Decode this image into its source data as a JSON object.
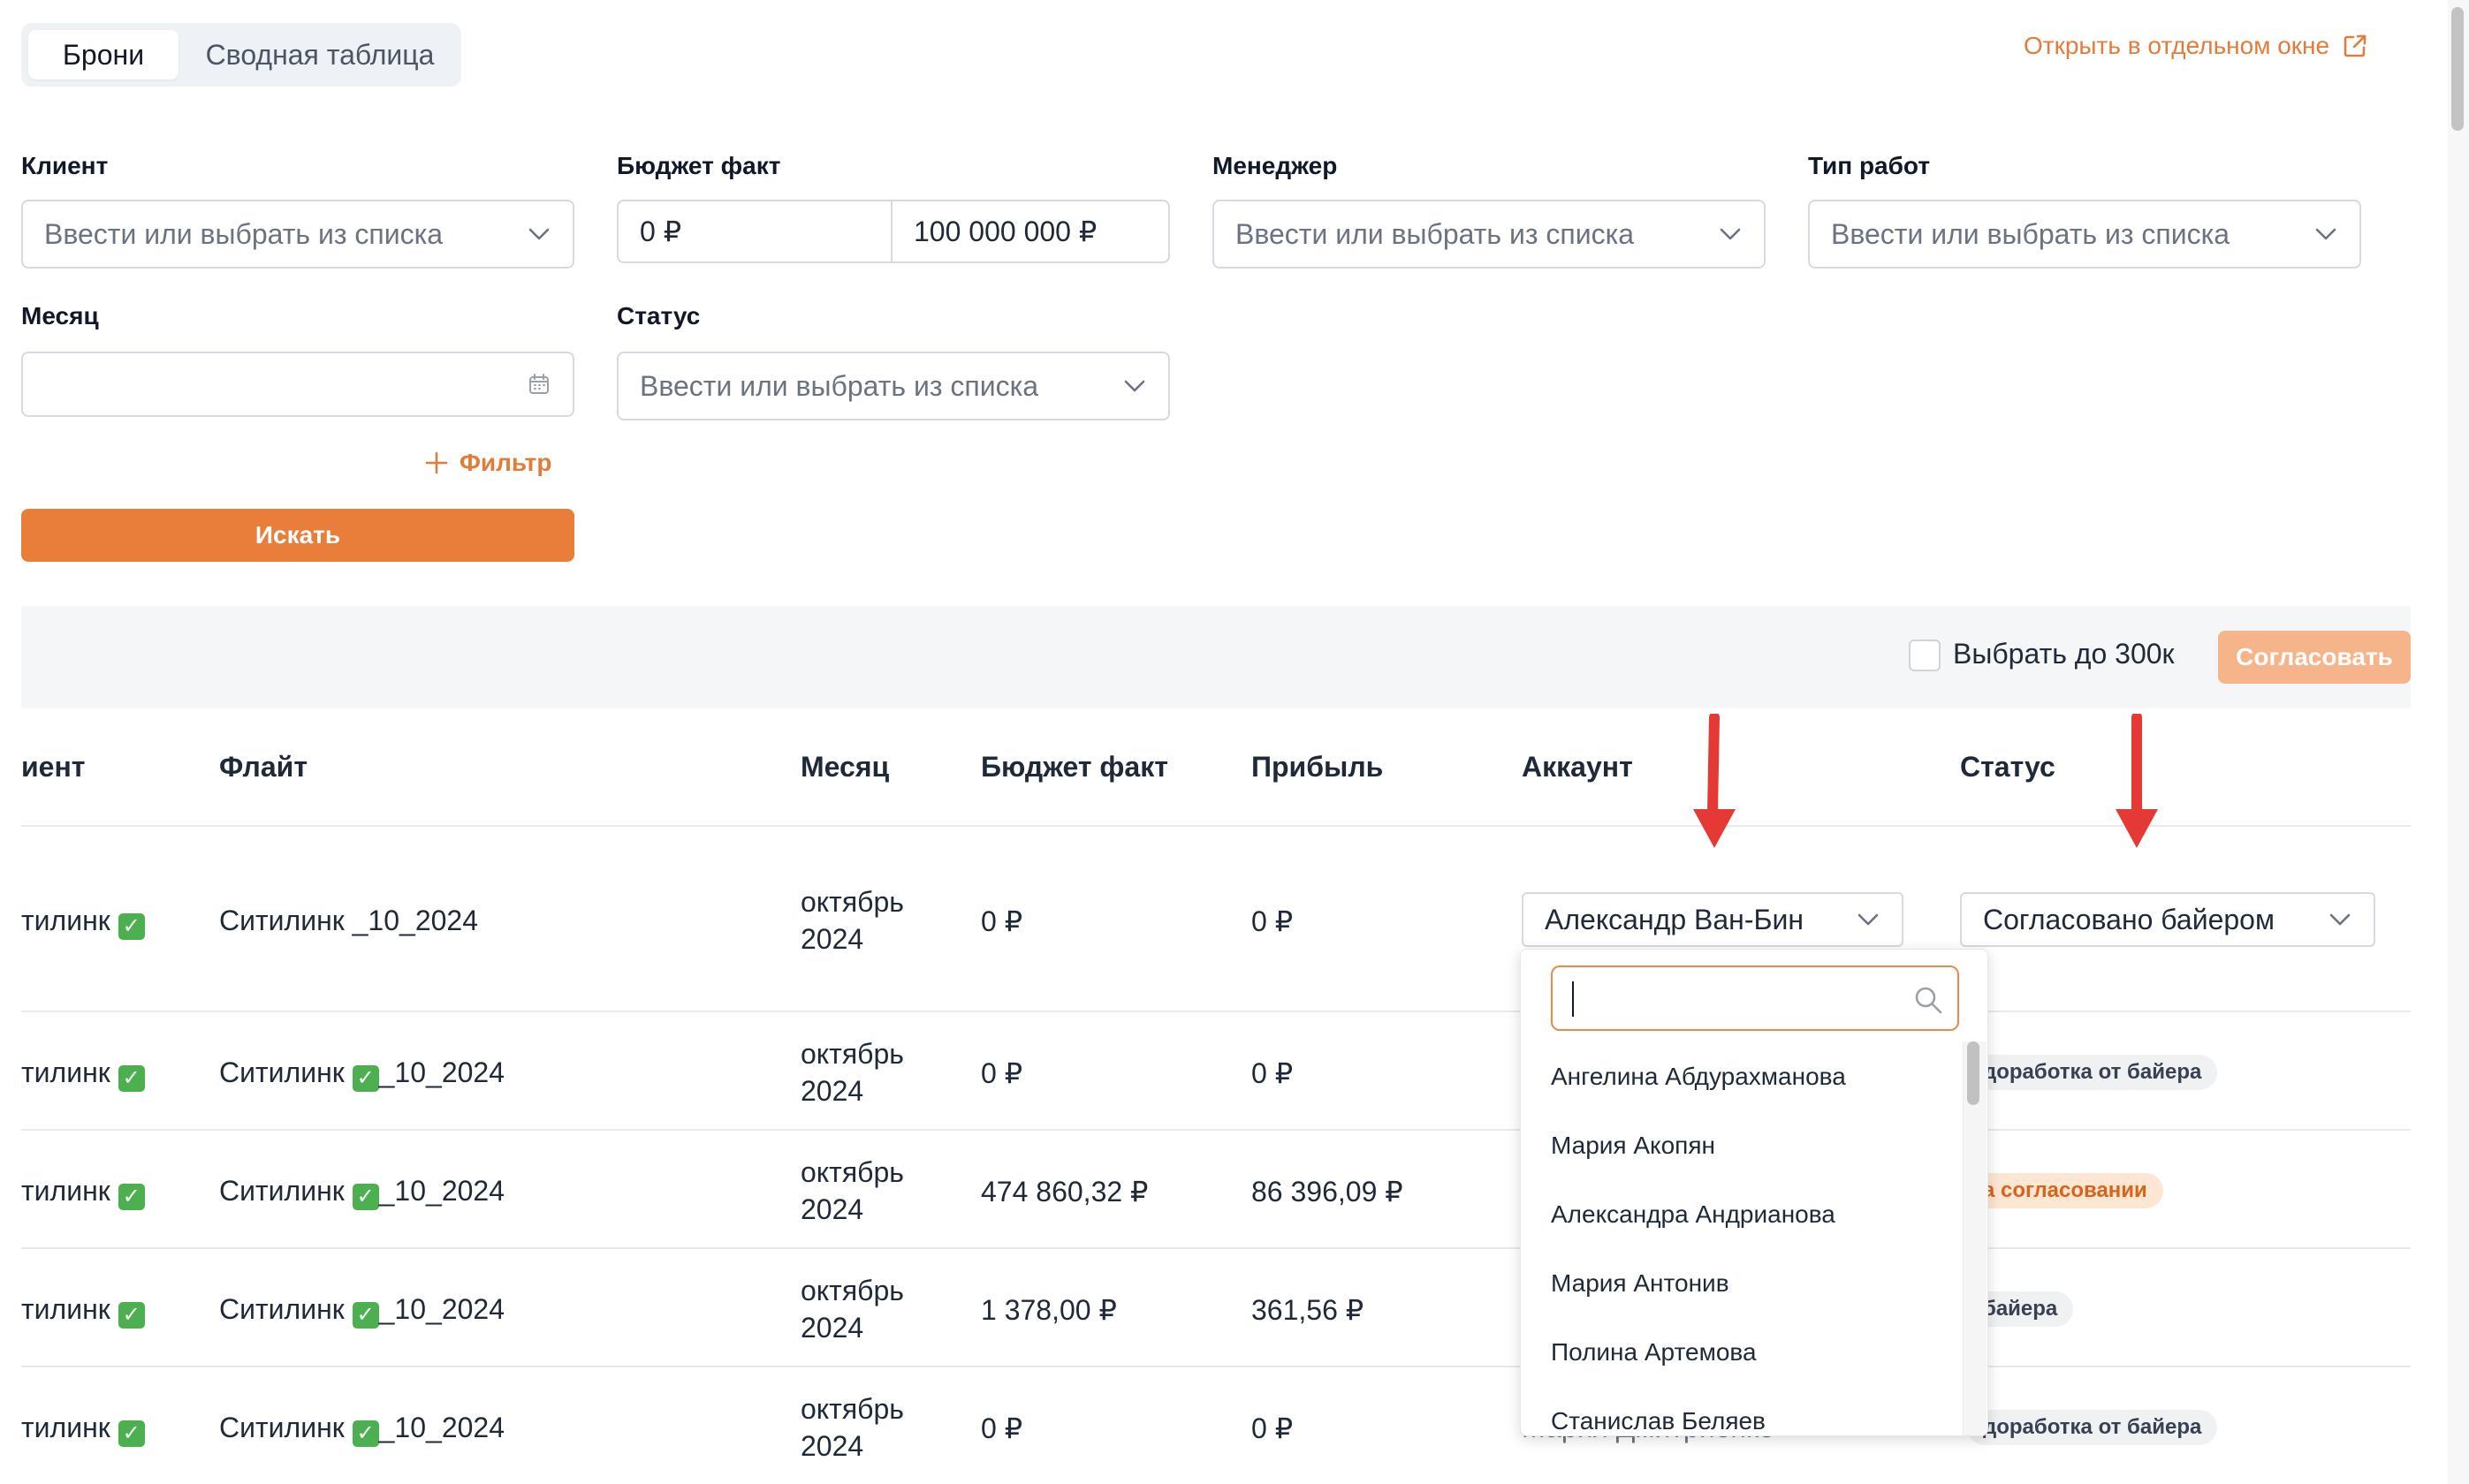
{
  "tabs": [
    "Брони",
    "Сводная таблица"
  ],
  "open_window_link": "Открыть в отдельном окне",
  "filters": {
    "client": {
      "label": "Клиент",
      "placeholder": "Ввести или выбрать из списка"
    },
    "budget": {
      "label": "Бюджет факт",
      "from": "0 ₽",
      "to": "100 000 000 ₽"
    },
    "manager": {
      "label": "Менеджер",
      "placeholder": "Ввести или выбрать из списка"
    },
    "work_type": {
      "label": "Тип работ",
      "placeholder": "Ввести или выбрать из списка"
    },
    "month": {
      "label": "Месяц",
      "value": ""
    },
    "status": {
      "label": "Статус",
      "placeholder": "Ввести или выбрать из списка"
    },
    "add_filter": "Фильтр",
    "search_button": "Искать"
  },
  "toolbar": {
    "select_upto_label": "Выбрать до 300к",
    "approve_button": "Согласовать"
  },
  "table": {
    "headers": [
      "иент",
      "Флайт",
      "Месяц",
      "Бюджет факт",
      "Прибыль",
      "Аккаунт",
      "Статус"
    ],
    "rows": [
      {
        "client": "тилинк",
        "flight_a": "Ситилинк _10_2024",
        "flight_b": "",
        "month1": "октябрь",
        "month2": "2024",
        "budget": "0 ₽",
        "profit": "0 ₽",
        "account": "Александр Ван-Бин",
        "status": "Согласовано байером"
      },
      {
        "client": "тилинк",
        "flight_a": "Ситилинк ",
        "flight_b": "_10_2024",
        "month1": "октябрь",
        "month2": "2024",
        "budget": "0 ₽",
        "profit": "0 ₽",
        "account": "",
        "status": "доработка от байера"
      },
      {
        "client": "тилинк",
        "flight_a": "Ситилинк ",
        "flight_b": "_10_2024",
        "month1": "октябрь",
        "month2": "2024",
        "budget": "474 860,32 ₽",
        "profit": "86 396,09 ₽",
        "account": "",
        "status": "а согласовании"
      },
      {
        "client": "тилинк",
        "flight_a": "Ситилинк ",
        "flight_b": "_10_2024",
        "month1": "октябрь",
        "month2": "2024",
        "budget": "1 378,00 ₽",
        "profit": "361,56 ₽",
        "account": "",
        "status": "байера"
      },
      {
        "client": "тилинк",
        "flight_a": "Ситилинк ",
        "flight_b": "_10_2024",
        "month1": "октябрь",
        "month2": "2024",
        "budget": "0 ₽",
        "profit": "0 ₽",
        "account": "Мария Дмитриенко",
        "status": "доработка от байера"
      }
    ]
  },
  "account_dropdown": {
    "search_value": "",
    "options": [
      "Ангелина Абдурахманова",
      "Мария Акопян",
      "Александра Андрианова",
      "Мария Антонив",
      "Полина Артемова",
      "Станислав Беляев"
    ]
  },
  "colors": {
    "accent": "#e97e3a",
    "accent_light": "#f6b48a",
    "arrow": "#e53935"
  }
}
